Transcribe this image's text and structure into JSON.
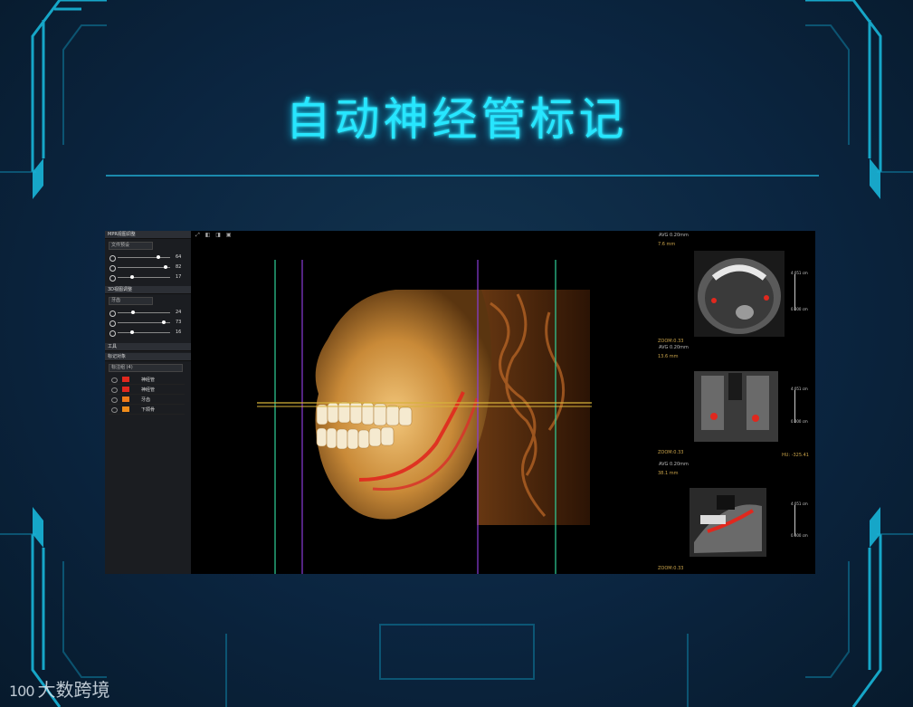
{
  "page": {
    "title": "自动神经管标记",
    "watermark": "大数跨境",
    "watermark_logo": "100"
  },
  "app": {
    "left_panel": {
      "mpr_header": "MPR视图调整",
      "mpr_preset": "文件预设",
      "mpr_sliders": [
        {
          "icon": "brightness-icon",
          "value": "64",
          "level": 0.78
        },
        {
          "icon": "contrast-icon",
          "value": "82",
          "level": 0.92
        },
        {
          "icon": "gamma-icon",
          "value": "17",
          "level": 0.28
        }
      ],
      "vr_header": "3D视图调整",
      "vr_preset": "牙齿",
      "vr_sliders": [
        {
          "icon": "opacity-icon",
          "value": "24",
          "level": 0.3
        },
        {
          "icon": "brightness-icon",
          "value": "73",
          "level": 0.88
        },
        {
          "icon": "contrast-icon",
          "value": "16",
          "level": 0.27
        }
      ],
      "tools_header": "工具",
      "objects_header": "标记对象",
      "objects_group": "标注组 (4)",
      "objects": [
        {
          "name": "神经管",
          "color": "#e0281e"
        },
        {
          "name": "神经管",
          "color": "#e0281e"
        },
        {
          "name": "牙齿",
          "color": "#f07a1a"
        },
        {
          "name": "下颌骨",
          "color": "#f08c1a"
        }
      ]
    },
    "viewport": {
      "toolbar": "⤢ ◧ ◨ ▣"
    },
    "right_panel": {
      "views": [
        {
          "mode": "AVG",
          "thickness": "0.20mm",
          "depth": "7.6 mm",
          "scale_top": "4.051 cm",
          "scale_bottom": "0.000 cm",
          "zoom": "ZOOM:0.33"
        },
        {
          "mode": "AVG",
          "thickness": "0.20mm",
          "depth": "13.6 mm",
          "scale_top": "4.051 cm",
          "scale_bottom": "0.000 cm",
          "zoom": "ZOOM:0.33"
        },
        {
          "mode": "AVG",
          "thickness": "0.20mm",
          "depth": "38.1 mm",
          "scale_top": "4.051 cm",
          "scale_bottom": "0.000 cm",
          "zoom": "ZOOM:0.33",
          "tag": "HU: -325.41"
        }
      ]
    }
  },
  "colors": {
    "title": "#27e6ff",
    "frame": "#1bb6d6",
    "nerve": "#e0281e",
    "guide_green": "#2fd29a",
    "guide_purple": "#8a3cd8",
    "guide_yellow": "#d7b23a"
  }
}
